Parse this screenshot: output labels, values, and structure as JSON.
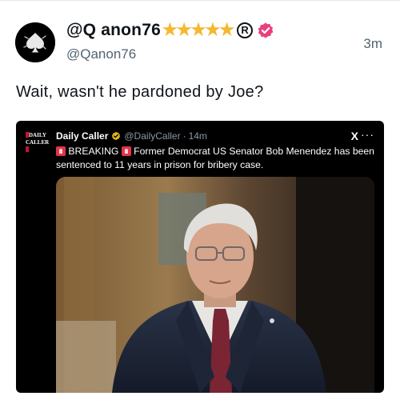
{
  "post": {
    "display_name": "@Q anon76",
    "stars": "★★★★★",
    "registered_mark": "R",
    "handle": "@Qanon76",
    "timestamp": "3m",
    "text": "Wait, wasn't he pardoned by Joe?",
    "avatar_icon": "spade-avatar-icon",
    "verified_icon": "pink-verified-badge-icon",
    "star_color": "#f5b82e",
    "badge_color": "#e8407d"
  },
  "embed": {
    "logo_line1": "DAILY",
    "logo_line2": "CALLER",
    "account_name": "Daily Caller",
    "account_handle": "@DailyCaller",
    "separator": "·",
    "time": "14m",
    "x_mark": "X",
    "more": "···",
    "breaking": "BREAKING",
    "headline": "Former Democrat US Senator Bob Menendez has been sentenced to 11 years in prison for bribery case.",
    "photo_icon": "man-in-suit-photo",
    "check_color": "#e2b719"
  }
}
